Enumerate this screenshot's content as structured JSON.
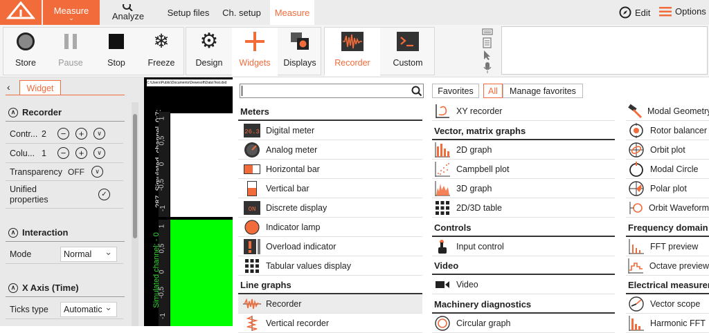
{
  "nav": {
    "measure": "Measure",
    "analyze": "Analyze",
    "setup_files": "Setup files",
    "ch_setup": "Ch. setup",
    "measure2": "Measure",
    "edit": "Edit",
    "options": "Options"
  },
  "toolbar": {
    "store": "Store",
    "pause": "Pause",
    "stop": "Stop",
    "freeze": "Freeze",
    "design": "Design",
    "widgets": "Widgets",
    "displays": "Displays",
    "recorder": "Recorder",
    "custom": "Custom"
  },
  "left": {
    "tab": "Widget",
    "recorder_title": "Recorder",
    "controls_label": "Contr...",
    "controls_value": "2",
    "columns_label": "Colu...",
    "columns_value": "1",
    "transparency_label": "Transparency",
    "transparency_value": "OFF",
    "unified_label_1": "Unified",
    "unified_label_2": "properties",
    "interaction_title": "Interaction",
    "mode_label": "Mode",
    "mode_value": "Normal",
    "xaxis_title": "X Axis (Time)",
    "ticks_label": "Ticks type",
    "ticks_value": "Automatic"
  },
  "chart": {
    "path": "C:\\Users\\Public\\Documents\\Dewesoft\\Data\\Test.dxd",
    "channel1": "287_Simulated_channel_0;7:",
    "channel2": "Simulated channel; - 0",
    "ticks1": [
      "1",
      "0,5",
      "0",
      "-0,5",
      "-1"
    ],
    "ticks2": [
      "1",
      "0,5",
      "0",
      "-0,5",
      "-1"
    ],
    "plot2_color": "#00ff00"
  },
  "menu": {
    "search_placeholder": "",
    "tabs": [
      "Favorites",
      "All",
      "Manage favorites"
    ],
    "col1": {
      "meters": "Meters",
      "meter_items": [
        "Digital meter",
        "Analog meter",
        "Horizontal bar",
        "Vertical bar",
        "Discrete display",
        "Indicator lamp",
        "Overload indicator",
        "Tabular values display"
      ],
      "line_graphs": "Line graphs",
      "line_items": [
        "Recorder",
        "Vertical recorder"
      ]
    },
    "col2": {
      "xy": "XY recorder",
      "vector_title": "Vector, matrix graphs",
      "vector_items": [
        "2D graph",
        "Campbell plot",
        "3D graph",
        "2D/3D table"
      ],
      "controls_title": "Controls",
      "controls_items": [
        "Input control"
      ],
      "video_title": "Video",
      "video_items": [
        "Video"
      ],
      "machinery_title": "Machinery diagnostics",
      "machinery_items": [
        "Circular graph"
      ]
    },
    "col3": {
      "top_items": [
        "Modal Geometry",
        "Rotor balancer",
        "Orbit plot",
        "Modal Circle",
        "Polar plot",
        "Orbit Waveform"
      ],
      "freq_title": "Frequency domain",
      "freq_items": [
        "FFT preview",
        "Octave preview"
      ],
      "elec_title": "Electrical measurements",
      "elec_items": [
        "Vector scope",
        "Harmonic FFT"
      ]
    }
  },
  "colors": {
    "accent": "#f26b3a"
  }
}
